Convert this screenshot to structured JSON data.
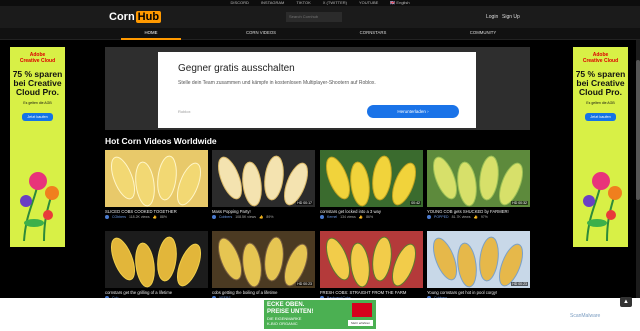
{
  "topbar": {
    "links": [
      "DISCORD",
      "INSTAGRAM",
      "TIKTOK",
      "X (TWITTER)",
      "YOUTUBE",
      "🇬🇧 English"
    ]
  },
  "header": {
    "logo_left": "Corn",
    "logo_right": "Hub",
    "search_placeholder": "Search Cornhub",
    "login": "Login",
    "signup": "Sign Up"
  },
  "nav": {
    "items": [
      "HOME",
      "CORN VIDEOS",
      "CORNSTARS",
      "COMMUNITY"
    ]
  },
  "side_ad": {
    "brand_line1": "Adobe",
    "brand_line2": "Creative Cloud",
    "offer": "75 % sparen bei Creative Cloud Pro.",
    "terms": "Es gelten die AGB",
    "button": "Jetzt kaufen"
  },
  "top_ad": {
    "title": "Gegner gratis ausschalten",
    "description": "Stelle dein Team zusammen und kämpfe in kostenlosen Multiplayer-Shootern auf Roblox.",
    "source": "Roblox",
    "button": "Herunterladen ›"
  },
  "section": {
    "title": "Hot Corn Videos Worldwide"
  },
  "videos": [
    {
      "title": "SLICED COBS COOKED TOGETHER",
      "channel": "CObbers",
      "views": "118.2K views",
      "rating": "88%",
      "hd": "",
      "duration": ""
    },
    {
      "title": "Mass Popping Party!",
      "channel": "Cobbers",
      "views": "108.5K views",
      "rating": "89%",
      "hd": "HD",
      "duration": "00:17"
    },
    {
      "title": "cornstars get locked into a 3 way",
      "channel": "Kernel",
      "views": "134 views",
      "rating": "86%",
      "hd": "",
      "duration": "00:42"
    },
    {
      "title": "YOUNG COB gets SHUCKED by FARMER!",
      "channel": "POPPED",
      "views": "81.7K views",
      "rating": "97%",
      "hd": "HD",
      "duration": "00:32"
    },
    {
      "title": "cornstars get the grilling of a lifetime",
      "channel": "Cob",
      "views": "",
      "rating": "",
      "hd": "",
      "duration": ""
    },
    {
      "title": "cobs getting the boiling of a lifetime",
      "channel": "YEEBS",
      "views": "",
      "rating": "",
      "hd": "HD",
      "duration": "00:23"
    },
    {
      "title": "FRESH COBS: STRAIGHT FROM THE FARM",
      "channel": "Backyard Cobs",
      "views": "",
      "rating": "",
      "hd": "",
      "duration": ""
    },
    {
      "title": "Young cornstars get hot in pool corgy!",
      "channel": "Cobbers",
      "views": "",
      "rating": "",
      "hd": "HD",
      "duration": "00:23"
    }
  ],
  "bottom_ad": {
    "line1": "ECKE OBEN.",
    "line2": "PREISE UNTEN!",
    "line3": "DIE EIGENMARKE",
    "line4": "K-BIO ORGANIC",
    "more": "Mehr erfahren"
  },
  "footer": {
    "scanmalware": "ScanMalware"
  }
}
